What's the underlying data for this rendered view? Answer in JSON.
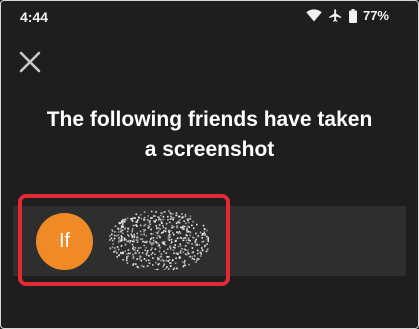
{
  "status_bar": {
    "time": "4:44",
    "battery": "77%",
    "icons": [
      "wifi-icon",
      "airplane-icon",
      "battery-icon"
    ]
  },
  "screen": {
    "close_icon": "close-icon",
    "title_line1": "The following friends have taken",
    "title_line2": "a screenshot"
  },
  "friends": [
    {
      "initials": "If",
      "avatar_color": "#ef8a26",
      "name": ""
    }
  ],
  "colors": {
    "background": "#1e1e1e",
    "row": "#2e2e2e",
    "highlight": "#e12b33",
    "avatar": "#ef8a26"
  }
}
